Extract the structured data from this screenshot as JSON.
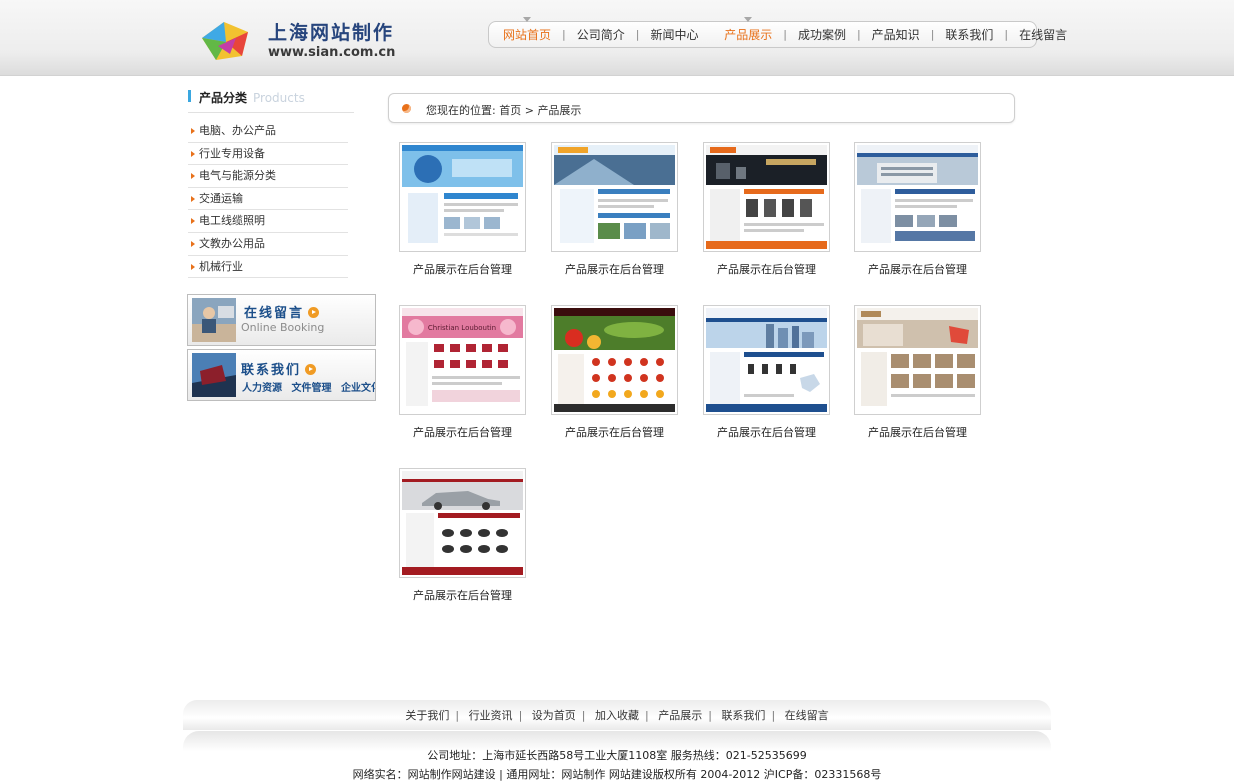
{
  "site": {
    "title": "上海网站制作",
    "url": "www.sian.com.cn"
  },
  "nav": {
    "items": [
      {
        "label": "网站首页",
        "active": true
      },
      {
        "label": "公司简介",
        "active": false
      },
      {
        "label": "新闻中心",
        "active": false
      },
      {
        "label": "产品展示",
        "active": true
      },
      {
        "label": "成功案例",
        "active": false
      },
      {
        "label": "产品知识",
        "active": false
      },
      {
        "label": "联系我们",
        "active": false
      },
      {
        "label": "在线留言",
        "active": false
      }
    ]
  },
  "sidebar": {
    "title": "产品分类",
    "title_en": "Products",
    "categories": [
      "电脑、办公产品",
      "行业专用设备",
      "电气与能源分类",
      "交通运输",
      "电工线缆照明",
      "文教办公用品",
      "机械行业"
    ],
    "promo_booking": {
      "title": "在线留言",
      "subtitle": "Online Booking"
    },
    "promo_contact": {
      "title": "联系我们",
      "links": [
        "人力资源",
        "文件管理",
        "企业文化"
      ]
    }
  },
  "breadcrumb": {
    "prefix": "您现在的位置:",
    "home": "首页",
    "sep": ">",
    "current": "产品展示"
  },
  "products": [
    {
      "caption": "产品展示在后台管理",
      "icon": "blue-corporate-site-thumb"
    },
    {
      "caption": "产品展示在后台管理",
      "icon": "steel-blue-site-thumb"
    },
    {
      "caption": "产品展示在后台管理",
      "icon": "dark-equipment-site-thumb"
    },
    {
      "caption": "产品展示在后台管理",
      "icon": "building-site-thumb"
    },
    {
      "caption": "产品展示在后台管理",
      "icon": "pink-shoes-site-thumb",
      "banner_text": "Christian Louboutin"
    },
    {
      "caption": "产品展示在后台管理",
      "icon": "food-site-thumb"
    },
    {
      "caption": "产品展示在后台管理",
      "icon": "city-skyline-site-thumb"
    },
    {
      "caption": "产品展示在后台管理",
      "icon": "interior-site-thumb"
    },
    {
      "caption": "产品展示在后台管理",
      "icon": "car-site-thumb"
    }
  ],
  "footer": {
    "links": [
      "关于我们",
      "行业资讯",
      "设为首页",
      "加入收藏",
      "产品展示",
      "联系我们",
      "在线留言"
    ],
    "address": "公司地址：上海市延长西路58号工业大厦1108室 服务热线：021-52535699",
    "copyright": "网络实名：网站制作网站建设 | 通用网址：网站制作 网站建设版权所有 2004-2012 沪ICP备：02331568号"
  },
  "colors": {
    "accent": "#e8711a",
    "brand": "#27457d",
    "link_blue": "#1c4f8a"
  }
}
